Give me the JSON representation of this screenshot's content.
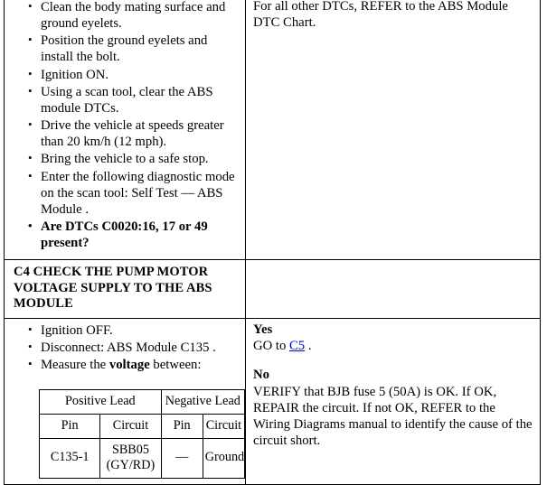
{
  "document": {
    "type": "diagnostic-procedure-table"
  },
  "rows": [
    {
      "id": "previous-step-continuation",
      "left": {
        "steps": [
          {
            "text": "Clean the body mating surface and ground eyelets.",
            "bold": false
          },
          {
            "text": "Position the ground eyelets and install the bolt.",
            "bold": false
          },
          {
            "text": "Ignition ON.",
            "bold": false
          },
          {
            "text": "Using a scan tool, clear the ABS module DTCs.",
            "bold": false
          },
          {
            "text": "Drive the vehicle at speeds greater than 20 km/h (12 mph).",
            "bold": false
          },
          {
            "text": "Bring the vehicle to a safe stop.",
            "bold": false
          },
          {
            "text": "Enter the following diagnostic mode on the scan tool: Self Test — ABS Module .",
            "bold": false
          },
          {
            "text": "Are DTCs C0020:16, 17 or 49 present?",
            "bold": true
          }
        ]
      },
      "right": {
        "text": "For all other DTCs, REFER to the ABS Module DTC Chart."
      }
    },
    {
      "id": "c4-step",
      "header": "C4 CHECK THE PUMP MOTOR VOLTAGE SUPPLY TO THE ABS MODULE",
      "left": {
        "steps": [
          {
            "text": "Ignition OFF.",
            "bold": false
          },
          {
            "text": "Disconnect: ABS Module C135 .",
            "bold": false
          },
          {
            "text": "Measure the ",
            "bold_part": "voltage",
            "text_after": " between:",
            "bold": false,
            "mixed": true
          }
        ],
        "measure_line": {
          "prefix": "Measure the ",
          "emphasis": "voltage",
          "suffix": " between:"
        },
        "table": {
          "group_headers": [
            "Positive Lead",
            "Negative Lead"
          ],
          "column_headers": [
            "Pin",
            "Circuit",
            "Pin",
            "Circuit"
          ],
          "rows": [
            [
              "C135-1",
              "SBB05 (GY/RD)",
              "—",
              "Ground"
            ]
          ]
        }
      },
      "right": {
        "yes_label": "Yes",
        "yes_text_prefix": "GO to ",
        "yes_link": "C5",
        "yes_text_suffix": " .",
        "no_label": "No",
        "no_text": "VERIFY that BJB fuse 5 (50A) is OK. If OK, REPAIR the circuit. If not OK, REFER to the Wiring Diagrams manual to identify the cause of the circuit short."
      }
    }
  ],
  "colors": {
    "text": "#000000",
    "link": "#0000cc",
    "border": "#000000",
    "background": "#ffffff"
  }
}
